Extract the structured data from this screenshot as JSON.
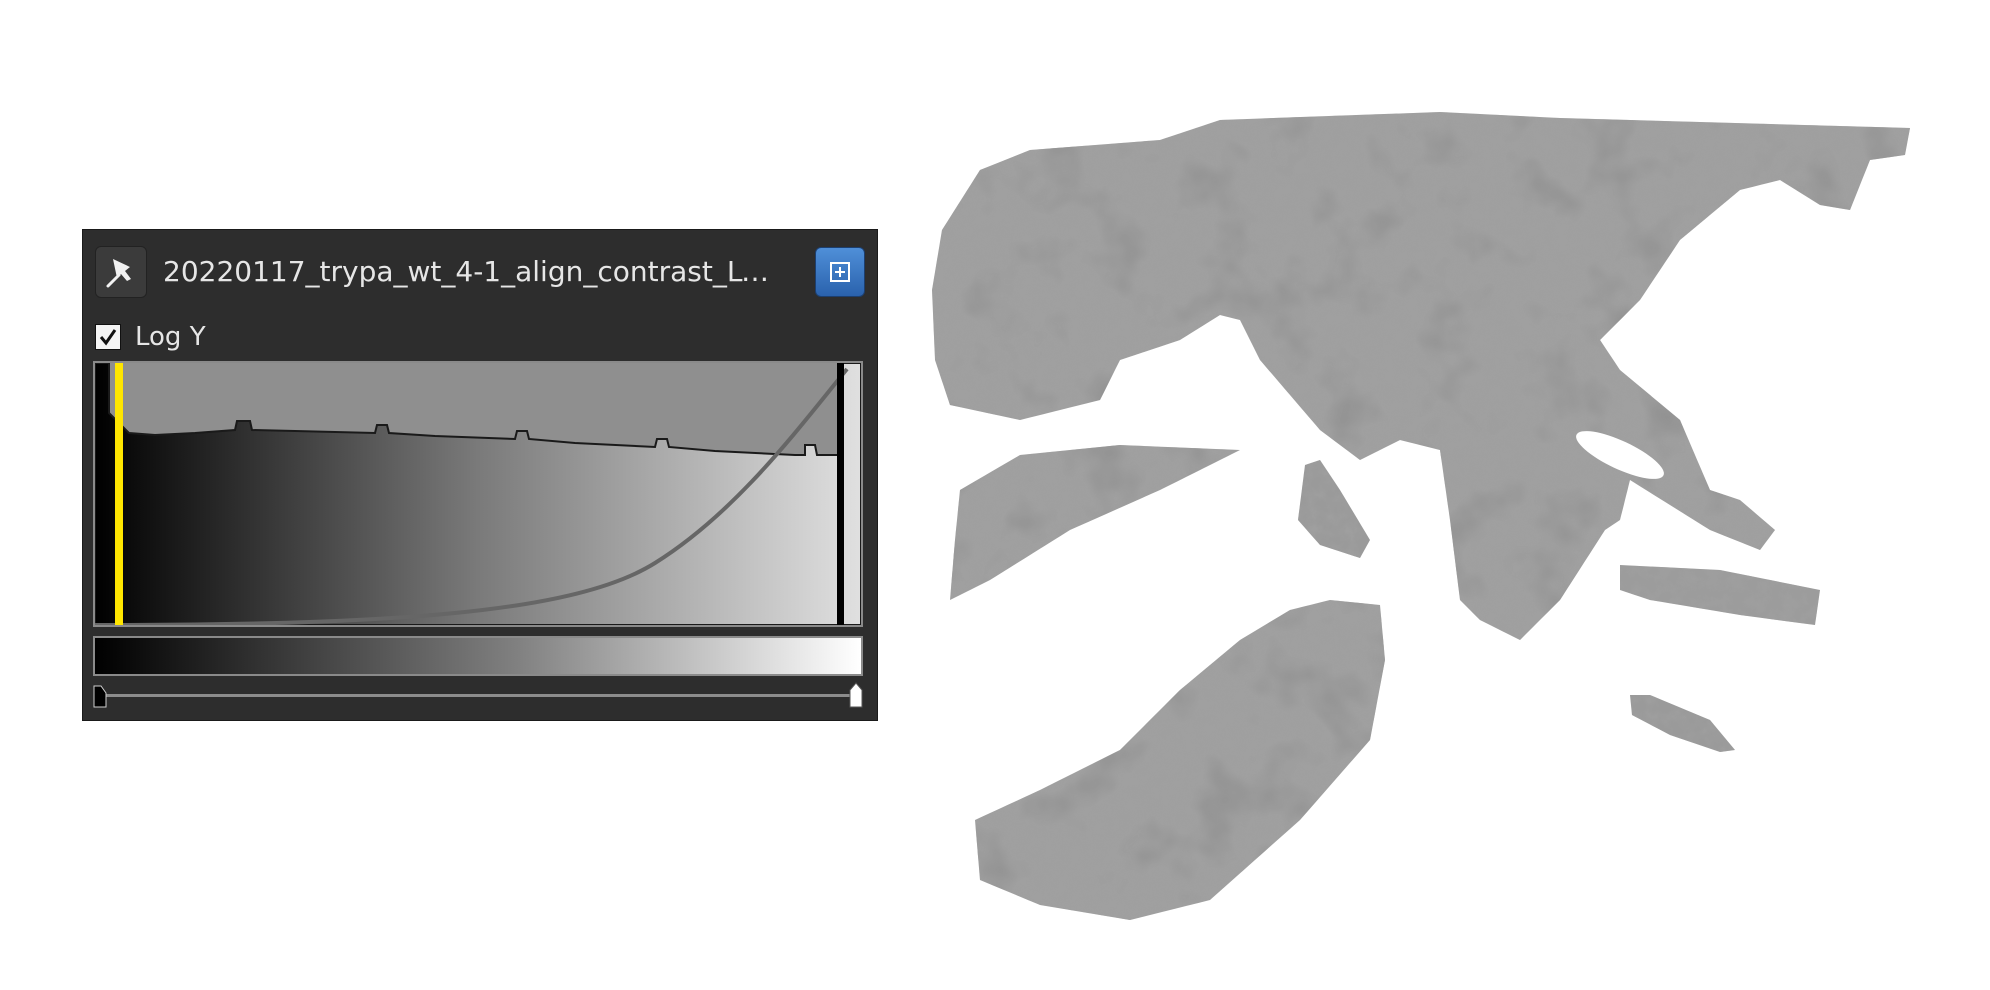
{
  "panel": {
    "title": "20220117_trypa_wt_4-1_align_contrast_LUT...",
    "log_y": {
      "label": "Log Y",
      "checked": true
    },
    "icons": {
      "pin": "pin-icon",
      "expand": "expand-icon",
      "check": "check-icon"
    },
    "colors": {
      "panel_bg": "#2d2d2d",
      "expand_button": "#3b78c4",
      "range_marker": "#ffe600",
      "opacity_curve": "#666666"
    },
    "range_min_fraction": 0.03,
    "range_max_fraction": 0.985,
    "range_slider": {
      "min_fraction": 0.0,
      "max_fraction": 1.0
    }
  },
  "render": {
    "description_icon": "volume-render"
  }
}
